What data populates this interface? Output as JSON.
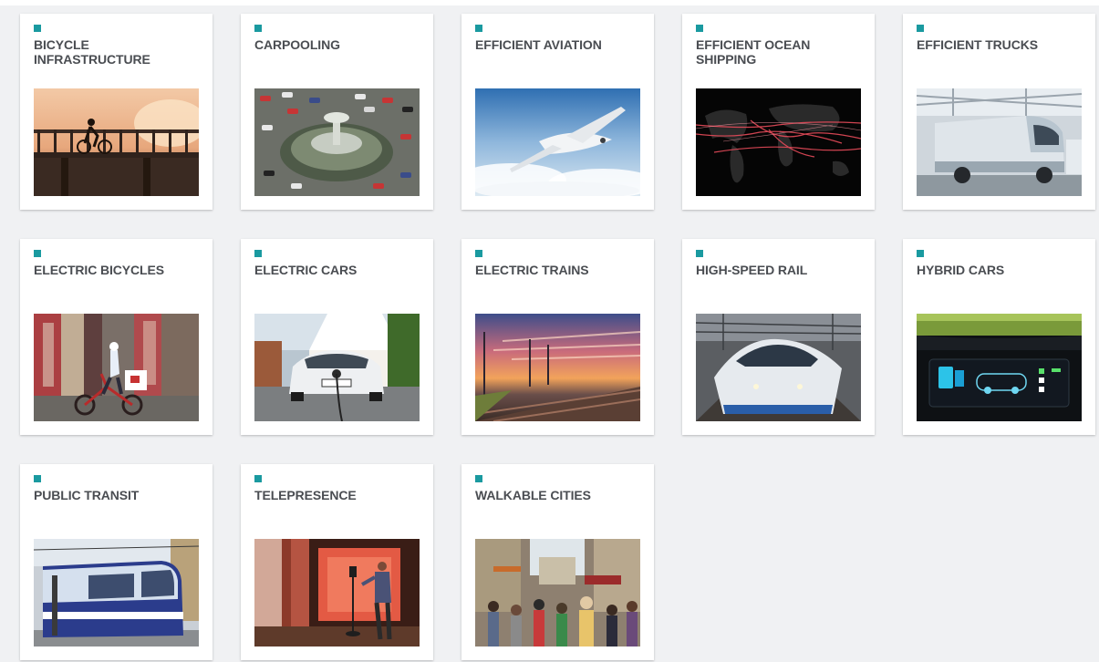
{
  "theme": {
    "accent": "#1a9aa0",
    "title_color": "#4a4d52",
    "page_background": "#f0f1f3",
    "card_background": "#ffffff"
  },
  "solutions": [
    {
      "id": "bicycle-infrastructure",
      "title": "BICYCLE INFRASTRUCTURE",
      "image_icon": "bicycle-infrastructure-photo"
    },
    {
      "id": "carpooling",
      "title": "CARPOOLING",
      "image_icon": "carpooling-photo"
    },
    {
      "id": "efficient-aviation",
      "title": "EFFICIENT AVIATION",
      "image_icon": "efficient-aviation-photo"
    },
    {
      "id": "efficient-ocean-shipping",
      "title": "EFFICIENT OCEAN SHIPPING",
      "image_icon": "efficient-ocean-shipping-photo"
    },
    {
      "id": "efficient-trucks",
      "title": "EFFICIENT TRUCKS",
      "image_icon": "efficient-trucks-photo"
    },
    {
      "id": "electric-bicycles",
      "title": "ELECTRIC BICYCLES",
      "image_icon": "electric-bicycles-photo"
    },
    {
      "id": "electric-cars",
      "title": "ELECTRIC CARS",
      "image_icon": "electric-cars-photo"
    },
    {
      "id": "electric-trains",
      "title": "ELECTRIC TRAINS",
      "image_icon": "electric-trains-photo"
    },
    {
      "id": "high-speed-rail",
      "title": "HIGH-SPEED RAIL",
      "image_icon": "high-speed-rail-photo"
    },
    {
      "id": "hybrid-cars",
      "title": "HYBRID CARS",
      "image_icon": "hybrid-cars-photo"
    },
    {
      "id": "public-transit",
      "title": "PUBLIC TRANSIT",
      "image_icon": "public-transit-photo"
    },
    {
      "id": "telepresence",
      "title": "TELEPRESENCE",
      "image_icon": "telepresence-photo"
    },
    {
      "id": "walkable-cities",
      "title": "WALKABLE CITIES",
      "image_icon": "walkable-cities-photo"
    }
  ]
}
